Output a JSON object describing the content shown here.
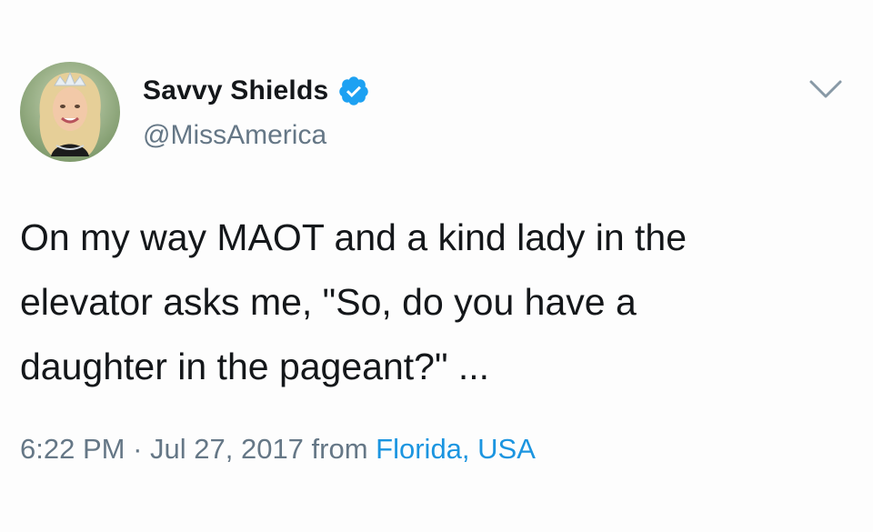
{
  "tweet": {
    "display_name": "Savvy Shields",
    "handle": "@MissAmerica",
    "verified_icon": "verified-badge-icon",
    "menu_icon": "chevron-down-icon",
    "text": "On my way MAOT and a kind lady in the\nelevator asks me, \"So, do you have a\ndaughter in the pageant?\" ...",
    "time": "6:22 PM",
    "separator": " · ",
    "date": "Jul 27, 2017",
    "from_label": " from ",
    "location": "Florida, USA"
  },
  "colors": {
    "text": "#14171a",
    "secondary": "#657786",
    "link": "#1b95e0",
    "verified": "#1da1f2"
  }
}
